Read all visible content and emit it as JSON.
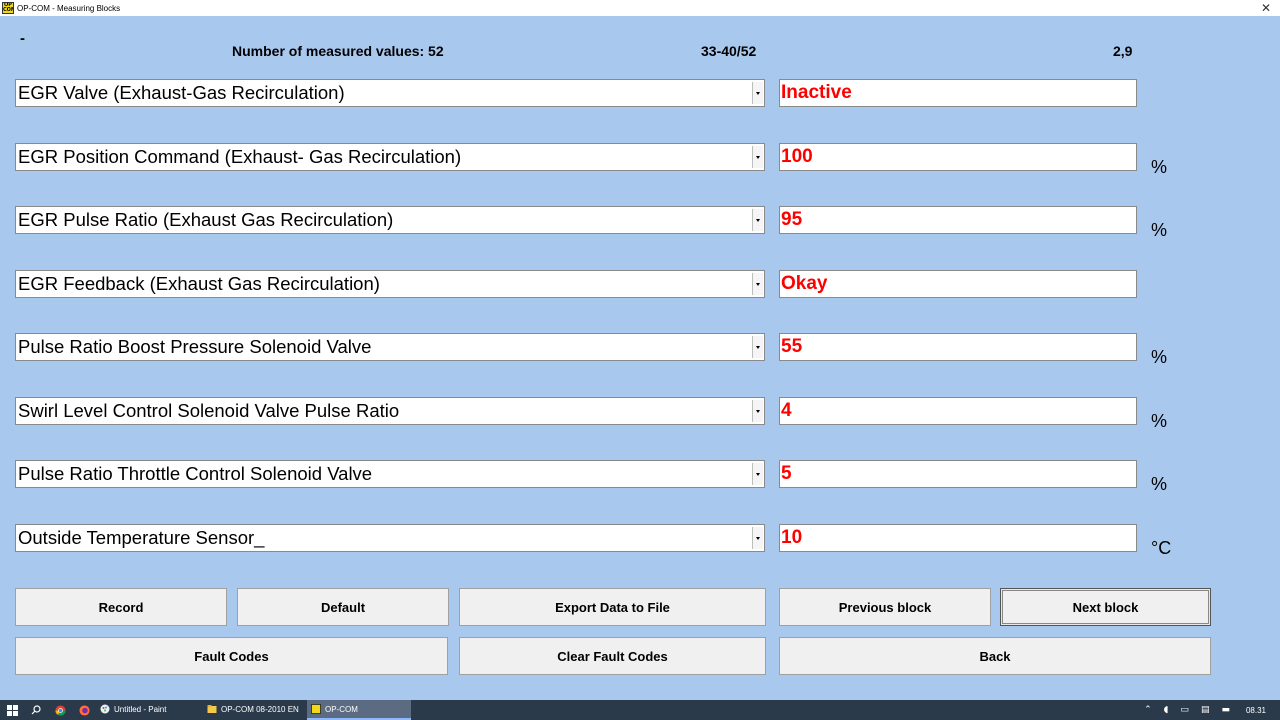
{
  "window": {
    "title": "OP-COM - Measuring Blocks",
    "logo_text": "OP COM",
    "close_glyph": "✕"
  },
  "header": {
    "dash": "-",
    "count_label": "Number of measured values: 52",
    "range": "33-40/52",
    "value": "2,9"
  },
  "rows": [
    {
      "param": "EGR Valve (Exhaust-Gas Recirculation)",
      "value": "Inactive",
      "unit": ""
    },
    {
      "param": "EGR Position Command (Exhaust- Gas Recirculation)",
      "value": "100",
      "unit": "%"
    },
    {
      "param": "EGR Pulse Ratio (Exhaust Gas Recirculation)",
      "value": "95",
      "unit": "%"
    },
    {
      "param": "EGR Feedback (Exhaust Gas Recirculation)",
      "value": "Okay",
      "unit": ""
    },
    {
      "param": "Pulse Ratio Boost Pressure Solenoid Valve",
      "value": "55",
      "unit": "%"
    },
    {
      "param": "Swirl Level Control Solenoid Valve Pulse Ratio",
      "value": "4",
      "unit": "%"
    },
    {
      "param": "Pulse Ratio Throttle Control Solenoid Valve",
      "value": "5",
      "unit": "%"
    },
    {
      "param": "Outside Temperature Sensor_",
      "value": "10",
      "unit": "°C"
    }
  ],
  "buttons": {
    "record": "Record",
    "default": "Default",
    "export": "Export Data to File",
    "previous_block": "Previous block",
    "next_block": "Next block",
    "fault_codes": "Fault Codes",
    "clear_fault_codes": "Clear Fault Codes",
    "back": "Back"
  },
  "taskbar": {
    "tasks": [
      {
        "label": "Untitled - Paint"
      },
      {
        "label": "OP-COM 08-2010 EN"
      },
      {
        "label": "OP-COM"
      }
    ],
    "clock": "08.31",
    "colors": {
      "value_text": "#ff0000",
      "background": "#a9c8ee",
      "taskbar": "#2b3a4b"
    }
  }
}
